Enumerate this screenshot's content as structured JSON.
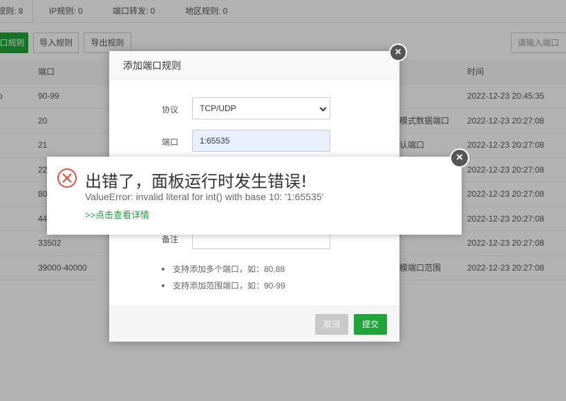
{
  "tabs": [
    {
      "label": "规则: 8"
    },
    {
      "label": "IP规则: 0"
    },
    {
      "label": "端口转发: 0"
    },
    {
      "label": "地区规则: 0"
    }
  ],
  "toolbar": {
    "add_label": "口规则",
    "import_label": "导入规则",
    "export_label": "导出规则",
    "search_placeholder": "请输入端口"
  },
  "table": {
    "headers": {
      "port": "端口",
      "time": "时间"
    },
    "rows": [
      {
        "proto": "p",
        "port": "90-99",
        "note": "",
        "time": "2022-12-23 20:45:35"
      },
      {
        "proto": "",
        "port": "20",
        "note": "被模式数据端口",
        "time": "2022-12-23 20:27:08"
      },
      {
        "proto": "",
        "port": "21",
        "note": "默认端口",
        "time": "2022-12-23 20:27:08"
      },
      {
        "proto": "",
        "port": "22",
        "note": "",
        "time": "2022-12-23 20:27:08"
      },
      {
        "proto": "",
        "port": "80",
        "note": "",
        "time": "2022-12-23 20:27:08"
      },
      {
        "proto": "",
        "port": "44",
        "note": "",
        "time": "2022-12-23 20:27:08"
      },
      {
        "proto": "",
        "port": "33502",
        "note": "",
        "time": "2022-12-23 20:27:08"
      },
      {
        "proto": "",
        "port": "39000-40000",
        "note": "被模端口范围",
        "time": "2022-12-23 20:27:08"
      }
    ]
  },
  "dialog": {
    "title": "添加端口规则",
    "protocol_label": "协议",
    "protocol_value": "TCP/UDP",
    "port_label": "端口",
    "port_value": "1:65535",
    "note_label": "备注",
    "tips": [
      "支持添加多个端口，如：80,88",
      "支持添加范围端口，如：90-99"
    ],
    "cancel_label": "取消",
    "submit_label": "提交",
    "close_symbol": "×"
  },
  "error": {
    "title": "出错了，面板运行时发生错误!",
    "message": "ValueError: invalid literal for int() with base 10: '1:65535'",
    "details_link": ">>点击查看详情",
    "close_symbol": "×",
    "icon": "error-circle-icon",
    "icon_color": "#e74c3c"
  },
  "colors": {
    "accent": "#20a53a"
  }
}
